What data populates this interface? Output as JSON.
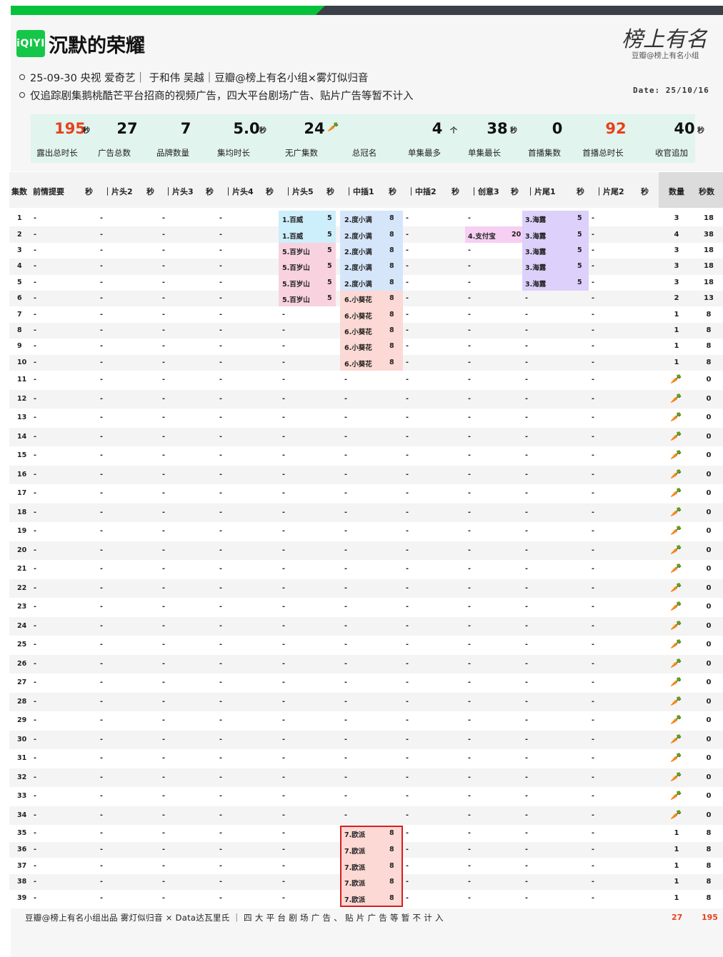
{
  "header": {
    "logo_text": "iQIYI",
    "title": "沉默的荣耀",
    "info_line1": "25-09-30 央视 爱奇艺｜ 于和伟 吴越｜豆瓣@榜上有名小组×雾灯似归音",
    "info_line2": "仅追踪剧集鹅桃酷芒平台招商的视频广告，四大平台剧场广告、贴片广告等暂不计入",
    "brand_signature": "榜上有名",
    "brand_sub": "豆瓣@榜上有名小组",
    "date": "Date: 25/10/16"
  },
  "stats": [
    {
      "value": "195",
      "unit": "秒",
      "label": "露出总时长",
      "red": true
    },
    {
      "value": "27",
      "unit": "",
      "label": "广告总数"
    },
    {
      "value": "7",
      "unit": "",
      "label": "品牌数量"
    },
    {
      "value": "5.0",
      "unit": "秒",
      "label": "集均时长"
    },
    {
      "value": "24",
      "unit": "",
      "label": "无广集数",
      "icon": "carrot-icon"
    },
    {
      "value": "",
      "unit": "",
      "label": "总冠名"
    },
    {
      "value": "4",
      "unit": "个",
      "label": "单集最多"
    },
    {
      "value": "38",
      "unit": "秒",
      "label": "单集最长"
    },
    {
      "value": "0",
      "unit": "",
      "label": "首播集数"
    },
    {
      "value": "92",
      "unit": "",
      "label": "首播总时长",
      "red": true
    },
    {
      "value": "40",
      "unit": "秒",
      "label": "收官追加"
    }
  ],
  "columns": [
    "集数",
    "前情提要",
    "秒",
    "｜片头2",
    "秒",
    "｜片头3",
    "秒",
    "｜片头4",
    "秒",
    "｜片头5",
    "秒",
    "｜中插1",
    "秒",
    "｜中插2",
    "秒",
    "｜创意3",
    "秒",
    "｜片尾1",
    "秒",
    "｜片尾2",
    "秒",
    "数量",
    "秒数"
  ],
  "dash": "-",
  "rows": [
    {
      "ep": "1",
      "p5": "1.百威",
      "p5s": "5",
      "m1": "2.度小满",
      "m1s": "8",
      "c3": "",
      "c3s": "",
      "w1": "3.海露",
      "w1s": "5",
      "n": "3",
      "t": "18"
    },
    {
      "ep": "2",
      "p5": "1.百威",
      "p5s": "5",
      "m1": "2.度小满",
      "m1s": "8",
      "c3": "4.支付宝",
      "c3s": "20",
      "w1": "3.海露",
      "w1s": "5",
      "n": "4",
      "t": "38"
    },
    {
      "ep": "3",
      "p5": "5.百岁山",
      "p5s": "5",
      "m1": "2.度小满",
      "m1s": "8",
      "c3": "",
      "c3s": "",
      "w1": "3.海露",
      "w1s": "5",
      "n": "3",
      "t": "18"
    },
    {
      "ep": "4",
      "p5": "5.百岁山",
      "p5s": "5",
      "m1": "2.度小满",
      "m1s": "8",
      "c3": "",
      "c3s": "",
      "w1": "3.海露",
      "w1s": "5",
      "n": "3",
      "t": "18"
    },
    {
      "ep": "5",
      "p5": "5.百岁山",
      "p5s": "5",
      "m1": "2.度小满",
      "m1s": "8",
      "c3": "",
      "c3s": "",
      "w1": "3.海露",
      "w1s": "5",
      "n": "3",
      "t": "18"
    },
    {
      "ep": "6",
      "p5": "5.百岁山",
      "p5s": "5",
      "m1": "6.小葵花",
      "m1s": "8",
      "c3": "",
      "c3s": "",
      "w1": "",
      "w1s": "",
      "n": "2",
      "t": "13"
    },
    {
      "ep": "7",
      "p5": "",
      "p5s": "",
      "m1": "6.小葵花",
      "m1s": "8",
      "c3": "",
      "c3s": "",
      "w1": "",
      "w1s": "",
      "n": "1",
      "t": "8"
    },
    {
      "ep": "8",
      "p5": "",
      "p5s": "",
      "m1": "6.小葵花",
      "m1s": "8",
      "c3": "",
      "c3s": "",
      "w1": "",
      "w1s": "",
      "n": "1",
      "t": "8"
    },
    {
      "ep": "9",
      "p5": "",
      "p5s": "",
      "m1": "6.小葵花",
      "m1s": "8",
      "c3": "",
      "c3s": "",
      "w1": "",
      "w1s": "",
      "n": "1",
      "t": "8"
    },
    {
      "ep": "10",
      "p5": "",
      "p5s": "",
      "m1": "6.小葵花",
      "m1s": "8",
      "c3": "",
      "c3s": "",
      "w1": "",
      "w1s": "",
      "n": "1",
      "t": "8"
    },
    {
      "ep": "11",
      "n": "carrot",
      "t": "0"
    },
    {
      "ep": "12",
      "n": "carrot",
      "t": "0"
    },
    {
      "ep": "13",
      "n": "carrot",
      "t": "0"
    },
    {
      "ep": "14",
      "n": "carrot",
      "t": "0"
    },
    {
      "ep": "15",
      "n": "carrot",
      "t": "0"
    },
    {
      "ep": "16",
      "n": "carrot",
      "t": "0"
    },
    {
      "ep": "17",
      "n": "carrot",
      "t": "0"
    },
    {
      "ep": "18",
      "n": "carrot",
      "t": "0"
    },
    {
      "ep": "19",
      "n": "carrot",
      "t": "0"
    },
    {
      "ep": "20",
      "n": "carrot",
      "t": "0"
    },
    {
      "ep": "21",
      "n": "carrot",
      "t": "0"
    },
    {
      "ep": "22",
      "n": "carrot",
      "t": "0"
    },
    {
      "ep": "23",
      "n": "carrot",
      "t": "0"
    },
    {
      "ep": "24",
      "n": "carrot",
      "t": "0"
    },
    {
      "ep": "25",
      "n": "carrot",
      "t": "0"
    },
    {
      "ep": "26",
      "n": "carrot",
      "t": "0"
    },
    {
      "ep": "27",
      "n": "carrot",
      "t": "0"
    },
    {
      "ep": "28",
      "n": "carrot",
      "t": "0"
    },
    {
      "ep": "29",
      "n": "carrot",
      "t": "0"
    },
    {
      "ep": "30",
      "n": "carrot",
      "t": "0"
    },
    {
      "ep": "31",
      "n": "carrot",
      "t": "0"
    },
    {
      "ep": "32",
      "n": "carrot",
      "t": "0"
    },
    {
      "ep": "33",
      "n": "carrot",
      "t": "0"
    },
    {
      "ep": "34",
      "n": "carrot",
      "t": "0"
    },
    {
      "ep": "35",
      "m1": "7.欧派",
      "m1s": "8",
      "n": "1",
      "t": "8"
    },
    {
      "ep": "36",
      "m1": "7.欧派",
      "m1s": "8",
      "n": "1",
      "t": "8"
    },
    {
      "ep": "37",
      "m1": "7.欧派",
      "m1s": "8",
      "n": "1",
      "t": "8"
    },
    {
      "ep": "38",
      "m1": "7.欧派",
      "m1s": "8",
      "n": "1",
      "t": "8"
    },
    {
      "ep": "39",
      "m1": "7.欧派",
      "m1s": "8",
      "n": "1",
      "t": "8"
    }
  ],
  "brand_colors": {
    "1.百威": "#cdeefb",
    "5.百岁山": "#f8d3df",
    "2.度小满": "#d5e6fb",
    "6.小葵花": "#fcd9d4",
    "7.欧派": "#fcd9d4",
    "4.支付宝": "#f6cff3",
    "3.海露": "#ddd0fb"
  },
  "footer": {
    "text": "豆瓣@榜上有名小组出品  雾灯似归音 × Data达瓦里氏 ｜ 四 大 平 台 剧 场 广 告 、 贴 片 广 告 等 暂 不 计 入",
    "total_count": "27",
    "total_seconds": "195"
  },
  "colors": {
    "accent_green": "#06c23a",
    "accent_red": "#e8401c",
    "stats_bg": "#e1f4ee"
  }
}
